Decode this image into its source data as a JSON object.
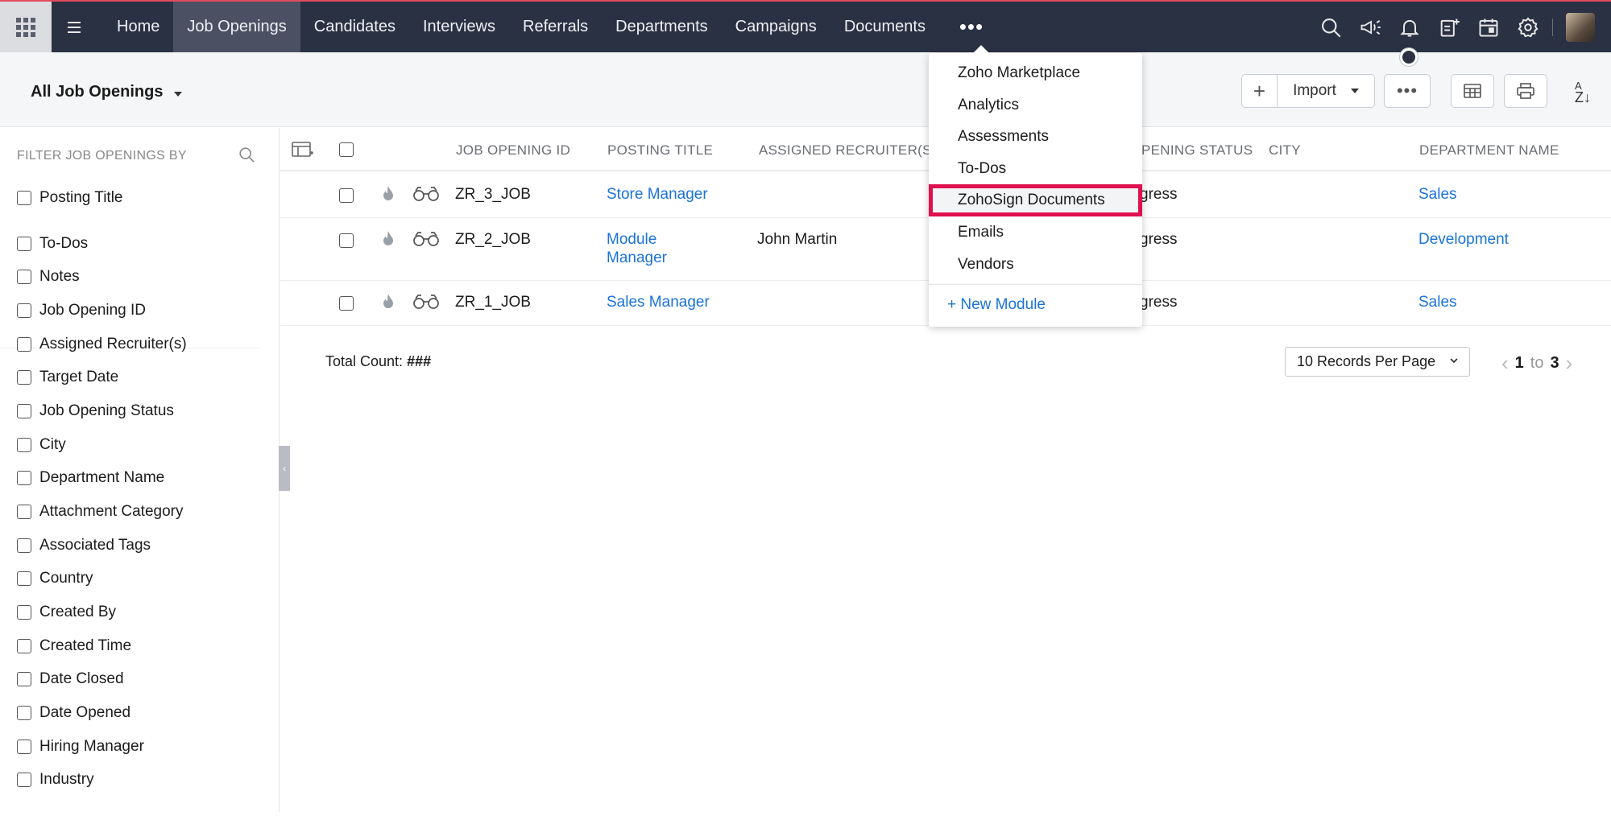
{
  "nav": {
    "tabs": [
      "Home",
      "Job Openings",
      "Candidates",
      "Interviews",
      "Referrals",
      "Departments",
      "Campaigns",
      "Documents"
    ],
    "active_tab": "Job Openings",
    "more_label": "•••"
  },
  "toolbar": {
    "view_label": "All Job Openings",
    "import_label": "Import",
    "add_symbol": "+",
    "more_label": "•••",
    "sort_label_top": "A",
    "sort_label_bottom": "Z↓"
  },
  "sidebar": {
    "header": "FILTER JOB OPENINGS BY",
    "pinned": "Posting Title",
    "filters": [
      "To-Dos",
      "Notes",
      "Job Opening ID",
      "Assigned Recruiter(s)",
      "Target Date",
      "Job Opening Status",
      "City",
      "Department Name",
      "Attachment Category",
      "Associated Tags",
      "Country",
      "Created By",
      "Created Time",
      "Date Closed",
      "Date Opened",
      "Hiring Manager",
      "Industry"
    ]
  },
  "table": {
    "columns": [
      "JOB OPENING ID",
      "POSTING TITLE",
      "ASSIGNED RECRUITER(S)",
      "PENING STATUS",
      "CITY",
      "DEPARTMENT NAME"
    ],
    "rows": [
      {
        "id": "ZR_3_JOB",
        "title_l1": "Store Manager",
        "title_l2": "",
        "recruiter": "",
        "status": "gress",
        "city": "",
        "department": "Sales"
      },
      {
        "id": "ZR_2_JOB",
        "title_l1": "Module",
        "title_l2": "Manager",
        "recruiter": "John Martin",
        "status": "gress",
        "city": "",
        "department": "Development"
      },
      {
        "id": "ZR_1_JOB",
        "title_l1": "Sales Manager",
        "title_l2": "",
        "recruiter": "",
        "status": "gress",
        "city": "",
        "department": "Sales"
      }
    ]
  },
  "footer": {
    "total_label": "Total Count:",
    "total_value": "###",
    "per_page": "10 Records Per Page",
    "page_from": "1",
    "page_to_label": "to",
    "page_to": "3"
  },
  "more_menu": {
    "items": [
      "Zoho Marketplace",
      "Analytics",
      "Assessments",
      "To-Dos",
      "ZohoSign Documents",
      "Emails",
      "Vendors"
    ],
    "highlighted": "ZohoSign Documents",
    "new_module": "+ New Module"
  },
  "colors": {
    "nav_bg": "#2a3143",
    "active_tab_bg": "#4b5163",
    "link": "#1a73d9",
    "highlight_border": "#e0104f"
  },
  "icons": {
    "nav_right": [
      "search-icon",
      "megaphone-icon",
      "bell-icon",
      "add-note-icon",
      "calendar-icon",
      "gear-icon"
    ]
  }
}
